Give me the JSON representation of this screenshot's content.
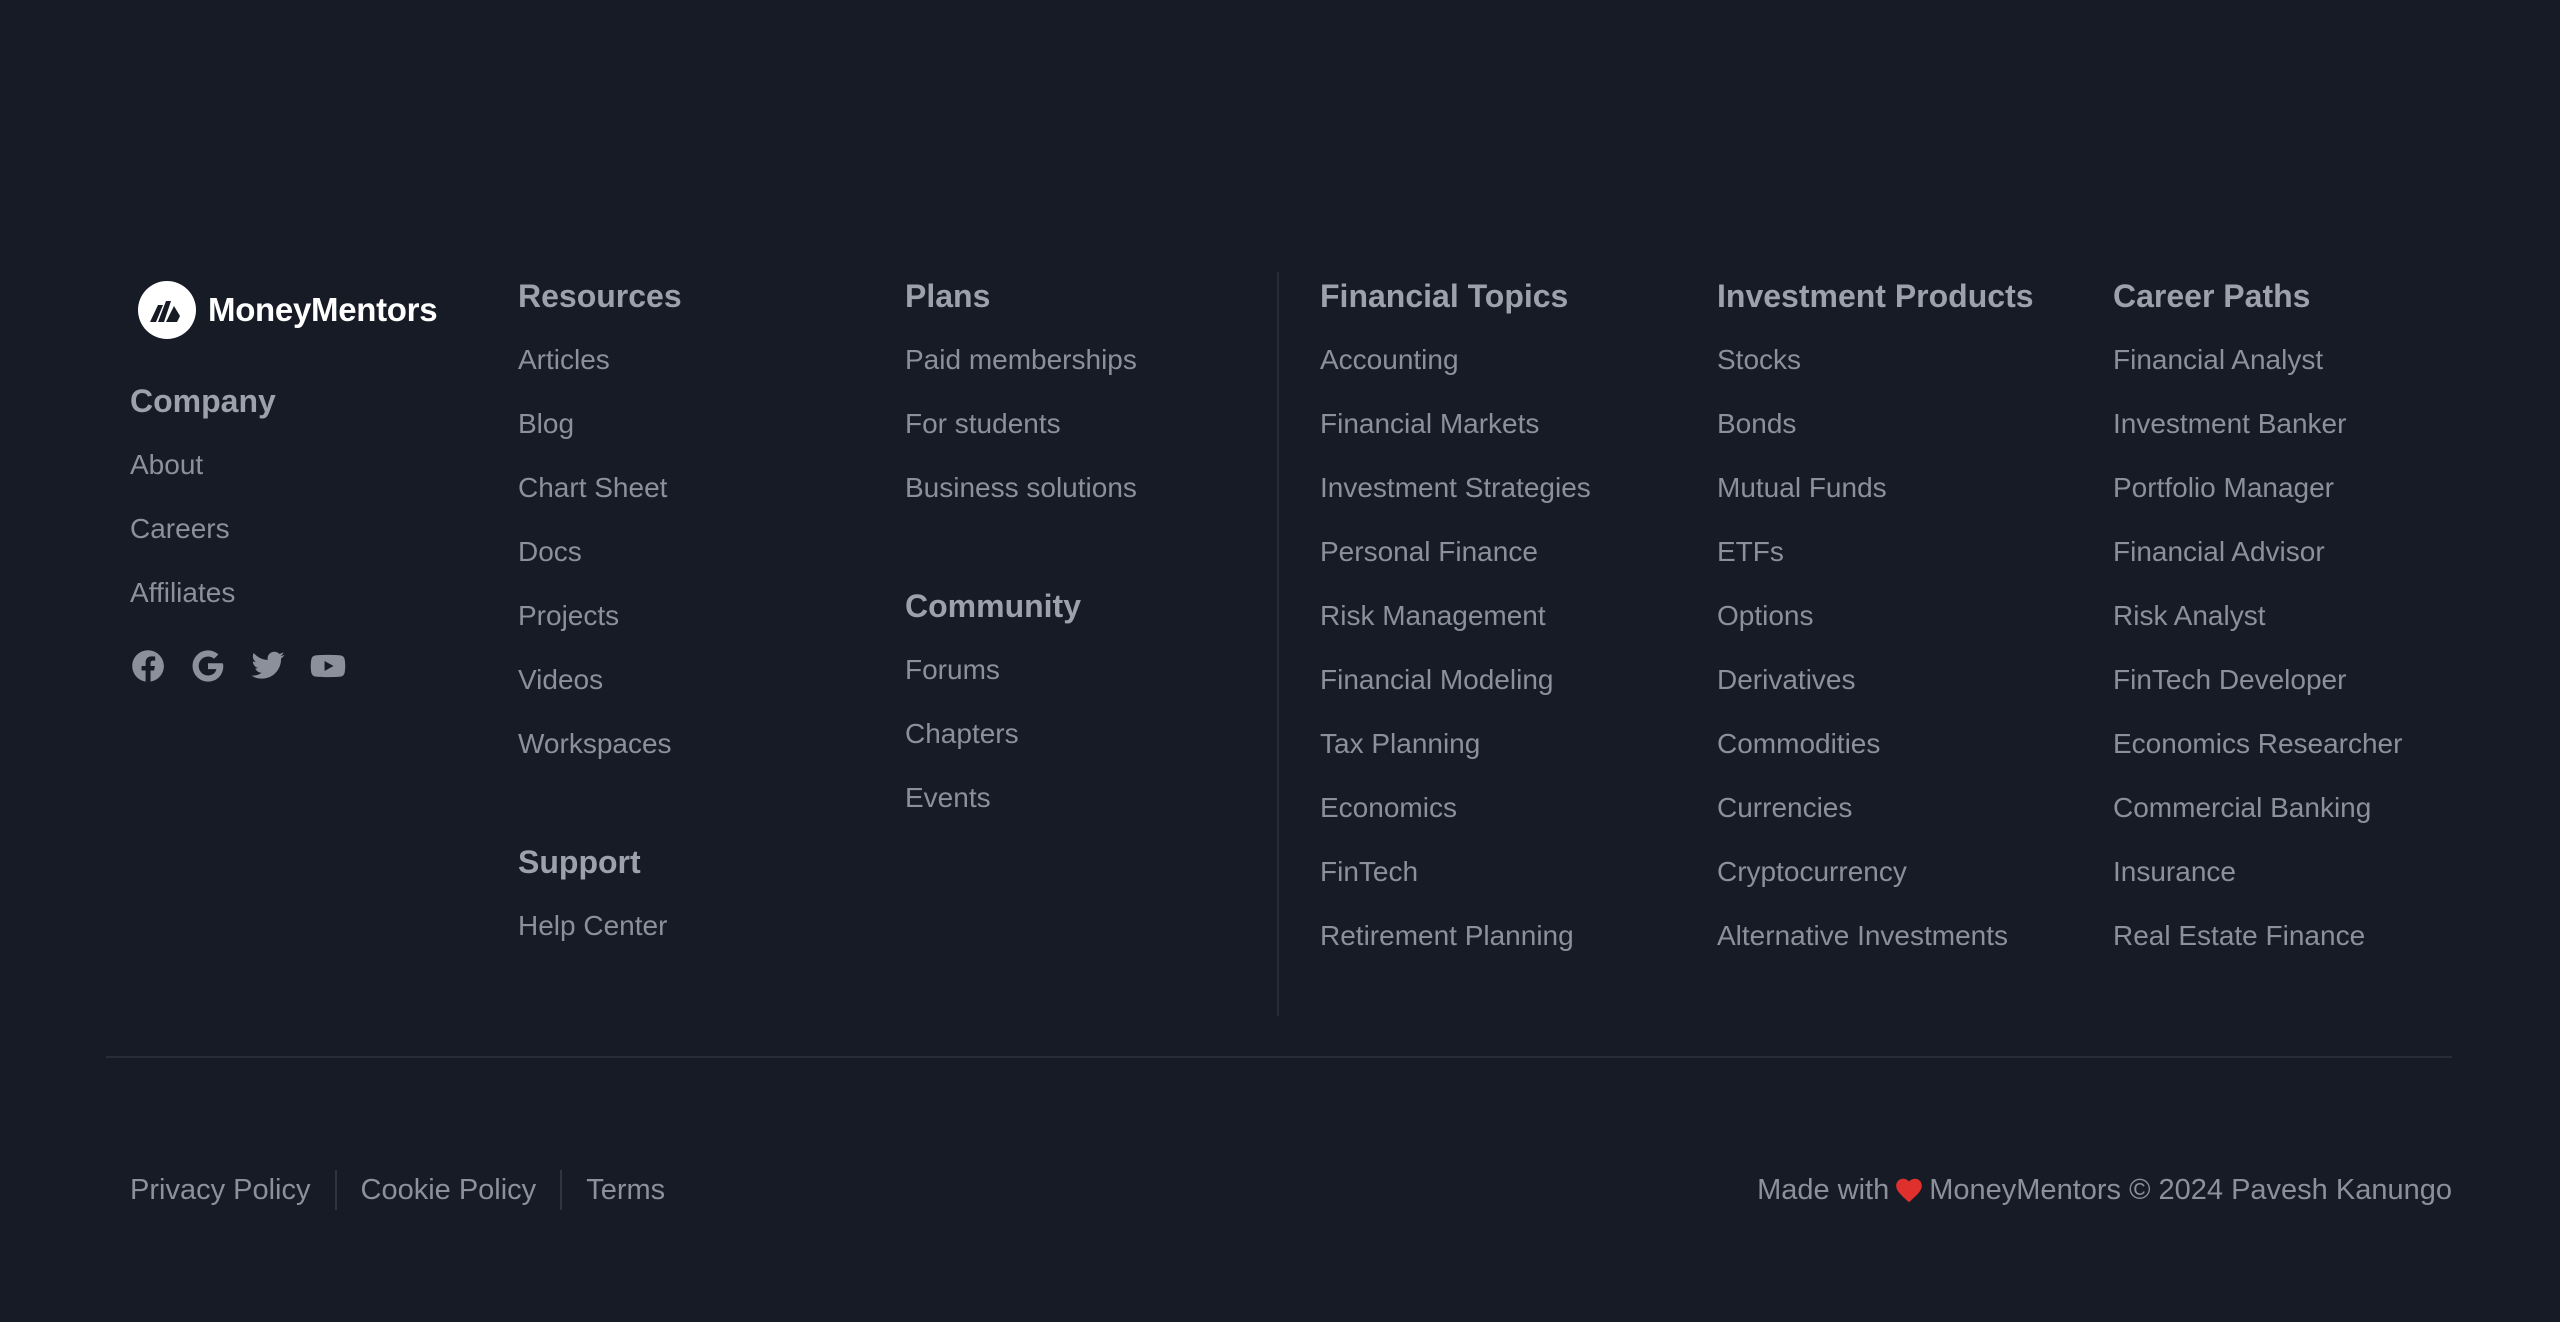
{
  "brand": {
    "name": "MoneyMentors"
  },
  "company": {
    "title": "Company",
    "links": [
      "About",
      "Careers",
      "Affiliates"
    ],
    "socials": [
      "facebook-icon",
      "google-icon",
      "twitter-icon",
      "youtube-icon"
    ]
  },
  "resources": {
    "title": "Resources",
    "links": [
      "Articles",
      "Blog",
      "Chart Sheet",
      "Docs",
      "Projects",
      "Videos",
      "Workspaces"
    ]
  },
  "support": {
    "title": "Support",
    "links": [
      "Help Center"
    ]
  },
  "plans": {
    "title": "Plans",
    "links": [
      "Paid memberships",
      "For students",
      "Business solutions"
    ]
  },
  "community": {
    "title": "Community",
    "links": [
      "Forums",
      "Chapters",
      "Events"
    ]
  },
  "financial_topics": {
    "title": "Financial Topics",
    "links": [
      "Accounting",
      "Financial Markets",
      "Investment Strategies",
      "Personal Finance",
      "Risk Management",
      "Financial Modeling",
      "Tax Planning",
      "Economics",
      "FinTech",
      "Retirement Planning"
    ]
  },
  "investment_products": {
    "title": "Investment Products",
    "links": [
      "Stocks",
      "Bonds",
      "Mutual Funds",
      "ETFs",
      "Options",
      "Derivatives",
      "Commodities",
      "Currencies",
      "Cryptocurrency",
      "Alternative Investments"
    ]
  },
  "career_paths": {
    "title": "Career Paths",
    "links": [
      "Financial Analyst",
      "Investment Banker",
      "Portfolio Manager",
      "Financial Advisor",
      "Risk Analyst",
      "FinTech Developer",
      "Economics Researcher",
      "Commercial Banking",
      "Insurance",
      "Real Estate Finance"
    ]
  },
  "legal": {
    "links": [
      "Privacy Policy",
      "Cookie Policy",
      "Terms"
    ]
  },
  "credit": {
    "prefix": "Made with",
    "suffix": "MoneyMentors © 2024 Pavesh Kanungo"
  },
  "colors": {
    "background": "#171b26",
    "text": "#8b909b",
    "heading": "#9ca1ab",
    "heart": "#e0302e",
    "logo": "#ffffff"
  }
}
